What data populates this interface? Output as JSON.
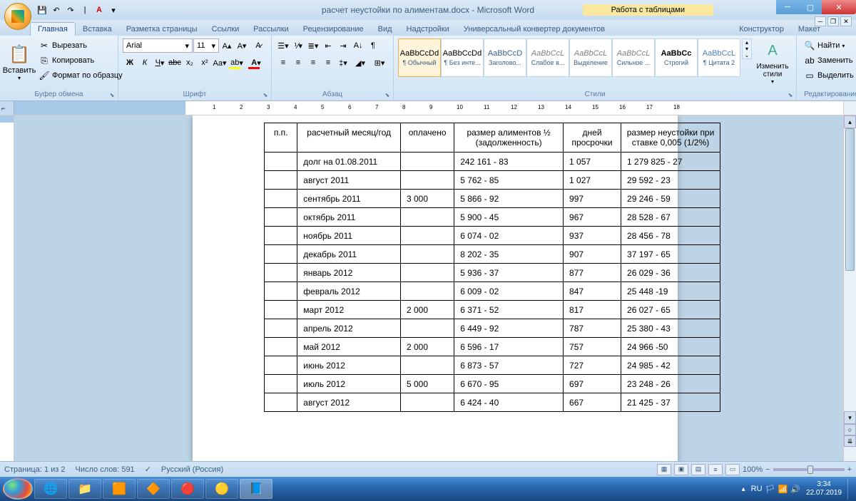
{
  "window": {
    "title": "расчет неустойки по алиментам.docx - Microsoft Word",
    "table_tools": "Работа с таблицами"
  },
  "tabs": {
    "home": "Главная",
    "insert": "Вставка",
    "layout": "Разметка страницы",
    "refs": "Ссылки",
    "mail": "Рассылки",
    "review": "Рецензирование",
    "view": "Вид",
    "addins": "Надстройки",
    "converter": "Универсальный конвертер документов",
    "design": "Конструктор",
    "tlayout": "Макет"
  },
  "ribbon": {
    "clipboard": {
      "label": "Буфер обмена",
      "paste": "Вставить",
      "cut": "Вырезать",
      "copy": "Копировать",
      "format_painter": "Формат по образцу"
    },
    "font": {
      "label": "Шрифт",
      "name": "Arial",
      "size": "11"
    },
    "paragraph": {
      "label": "Абзац"
    },
    "styles": {
      "label": "Стили",
      "change": "Изменить стили",
      "items": [
        {
          "preview": "AaBbCcDd",
          "name": "¶ Обычный"
        },
        {
          "preview": "AaBbCcDd",
          "name": "¶ Без инте..."
        },
        {
          "preview": "AaBbCcD",
          "name": "Заголово..."
        },
        {
          "preview": "AaBbCcL",
          "name": "Слабое в..."
        },
        {
          "preview": "AaBbCcL",
          "name": "Выделение"
        },
        {
          "preview": "AaBbCcL",
          "name": "Сильное ..."
        },
        {
          "preview": "AaBbCc",
          "name": "Строгий"
        },
        {
          "preview": "AaBbCcL",
          "name": "¶ Цитата 2"
        }
      ]
    },
    "editing": {
      "label": "Редактирование",
      "find": "Найти",
      "replace": "Заменить",
      "select": "Выделить"
    }
  },
  "table": {
    "headers": {
      "pp": "п.п.",
      "month": "расчетный месяц/год",
      "paid": "оплачено",
      "size": "размер алиментов ½ (задолженность)",
      "days": "дней просрочки",
      "penalty": "размер неустойки при ставке 0,005 (1/2%)"
    },
    "rows": [
      {
        "month": "долг на 01.08.2011",
        "paid": "",
        "size": "242 161 - 83",
        "days": "1 057",
        "penalty": "1 279 825 - 27"
      },
      {
        "month": "август 2011",
        "paid": "",
        "size": "5 762 - 85",
        "days": "1 027",
        "penalty": "29 592 - 23"
      },
      {
        "month": "сентябрь 2011",
        "paid": "3 000",
        "size": "5 866 - 92",
        "days": "997",
        "penalty": "29 246 - 59"
      },
      {
        "month": "октябрь 2011",
        "paid": "",
        "size": "5 900 - 45",
        "days": "967",
        "penalty": "28 528 - 67"
      },
      {
        "month": "ноябрь 2011",
        "paid": "",
        "size": "6 074 - 02",
        "days": "937",
        "penalty": "28 456 - 78"
      },
      {
        "month": "декабрь 2011",
        "paid": "",
        "size": "8 202 - 35",
        "days": "907",
        "penalty": "37 197 - 65"
      },
      {
        "month": "январь 2012",
        "paid": "",
        "size": "5 936 - 37",
        "days": "877",
        "penalty": "26 029 - 36"
      },
      {
        "month": "февраль 2012",
        "paid": "",
        "size": "6 009 - 02",
        "days": "847",
        "penalty": "25 448 -19"
      },
      {
        "month": "март 2012",
        "paid": "2 000",
        "size": "6 371 - 52",
        "days": "817",
        "penalty": "26 027 - 65"
      },
      {
        "month": "апрель 2012",
        "paid": "",
        "size": "6 449 - 92",
        "days": "787",
        "penalty": "25 380 - 43"
      },
      {
        "month": "май 2012",
        "paid": "2 000",
        "size": "6 596 - 17",
        "days": "757",
        "penalty": "24 966 -50"
      },
      {
        "month": "июнь 2012",
        "paid": "",
        "size": "6 873 - 57",
        "days": "727",
        "penalty": "24 985 - 42"
      },
      {
        "month": "июль 2012",
        "paid": "5 000",
        "size": "6 670 - 95",
        "days": "697",
        "penalty": "23 248 - 26"
      },
      {
        "month": "август 2012",
        "paid": "",
        "size": "6 424 - 40",
        "days": "667",
        "penalty": "21 425 - 37"
      }
    ]
  },
  "status": {
    "page": "Страница: 1 из 2",
    "words": "Число слов: 591",
    "lang": "Русский (Россия)",
    "zoom": "100%"
  },
  "tray": {
    "lang": "RU",
    "time": "3:34",
    "date": "22.07.2019"
  }
}
